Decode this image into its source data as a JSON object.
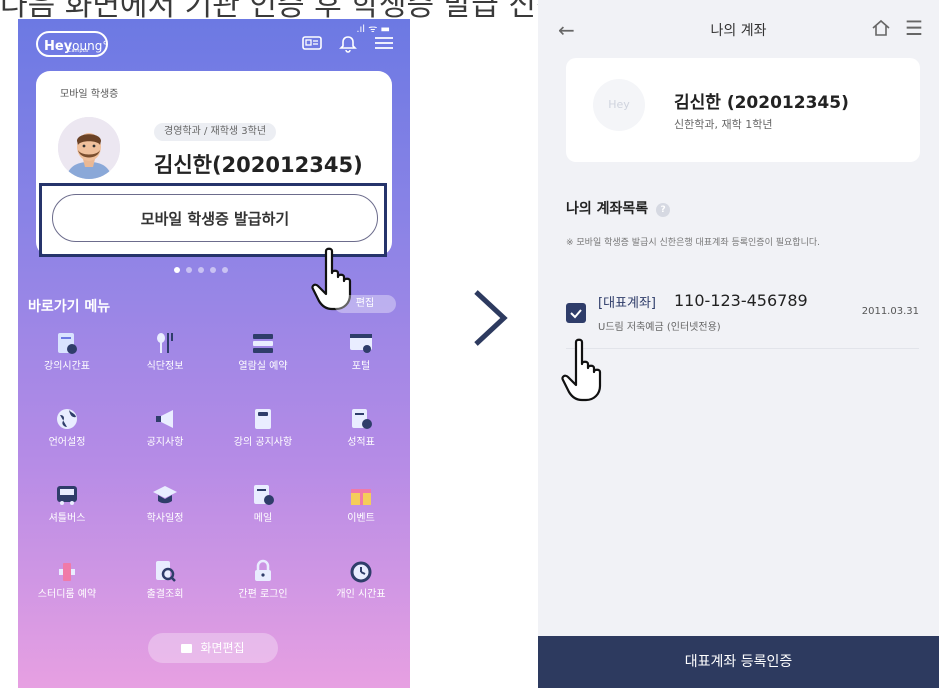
{
  "caption": "다음 화면에서 기관 인증 후 학생증 발급 신청합니다.",
  "left": {
    "status_bar": ".ıl ᯤ ▬",
    "logo_main": "Hey",
    "logo_suffix": "oung°",
    "logo_sub": "Campus",
    "card_title": "모바일 학생증",
    "dept_pill": "경영학과 / 재학생 3학년",
    "student_name": "김신한(202012345)",
    "issue_button": "모바일 학생증 발급하기",
    "quick_menu_title": "바로가기 메뉴",
    "edit_label": "편집",
    "menu_items": [
      "강의시간표",
      "식단정보",
      "열람실 예약",
      "포털",
      "언어설정",
      "공지사항",
      "강의 공지사항",
      "성적표",
      "셔틀버스",
      "학사일정",
      "메일",
      "이벤트",
      "스터디룸 예약",
      "출결조회",
      "간편 로그인",
      "개인 시간표"
    ],
    "edit_screen_button": "화면편집"
  },
  "right": {
    "back_icon": "←",
    "title": "나의 계좌",
    "menu_icon": "☰",
    "profile_logo": "Hey",
    "profile_name": "김신한 (202012345)",
    "profile_dept": "신한학과, 재학 1학년",
    "accounts_header": "나의 계좌목록",
    "help_icon": "?",
    "accounts_note": "※ 모바일 학생증 발급시 신한은행 대표계좌 등록인증이 필요합니다.",
    "account": {
      "type": "[대표계좌]",
      "number": "110-123-456789",
      "date": "2011.03.31",
      "product": "U드림 저축예금 (인터넷전용)",
      "checked": true
    },
    "bottom_button": "대표계좌 등록인증"
  },
  "colors": {
    "navy": "#2d3a5f",
    "highlight_border": "#26346b",
    "gradient_top": "#6c79e3",
    "gradient_bottom": "#e7a0e2"
  }
}
